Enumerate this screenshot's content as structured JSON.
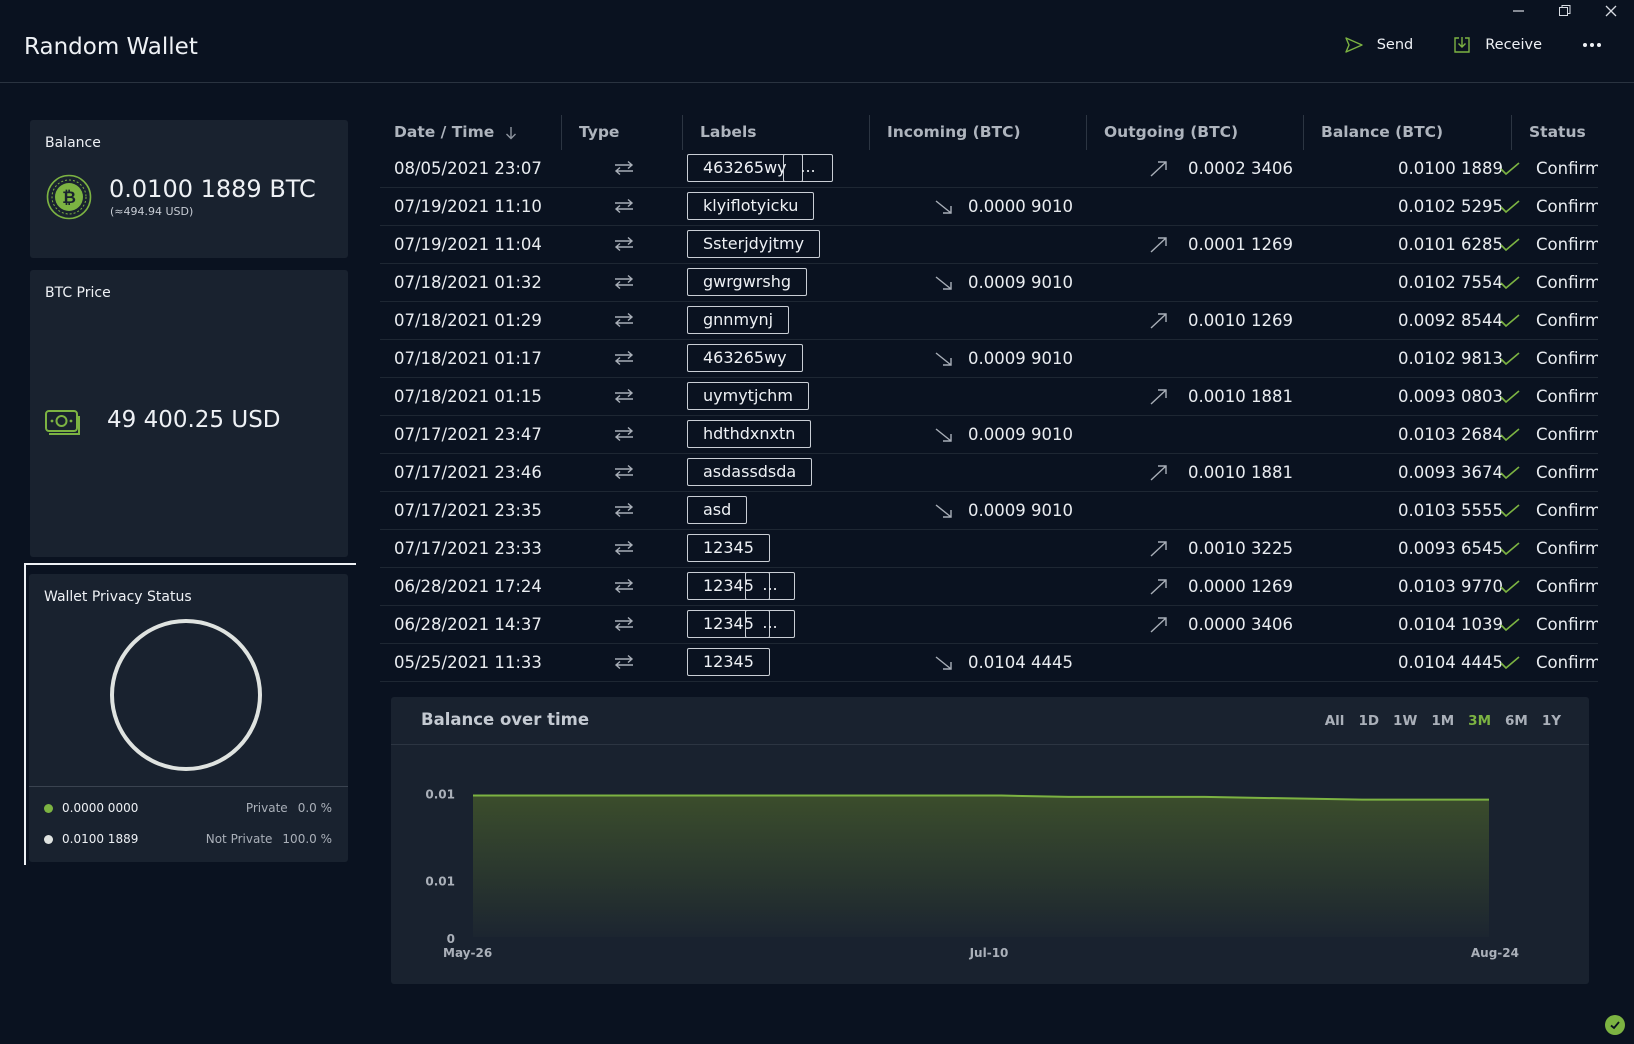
{
  "window": {
    "title": "Random Wallet",
    "controls": [
      "minimize-icon",
      "restore-icon",
      "close-icon"
    ]
  },
  "header": {
    "send_label": "Send",
    "receive_label": "Receive",
    "more_icon": "more-icon"
  },
  "balance_tile": {
    "title": "Balance",
    "amount": "0.0100 1889 BTC",
    "usd": "(≈494.94 USD)"
  },
  "price_tile": {
    "title": "BTC Price",
    "value": "49 400.25 USD"
  },
  "privacy_tile": {
    "title": "Wallet Privacy Status",
    "rows": [
      {
        "amount": "0.0000 0000",
        "label": "Private",
        "pct": "0.0 %",
        "color": "#7cb342"
      },
      {
        "amount": "0.0100 1889",
        "label": "Not Private",
        "pct": "100.0 %",
        "color": "#dfe3e0"
      }
    ]
  },
  "table": {
    "headers": {
      "date": "Date / Time",
      "type": "Type",
      "labels": "Labels",
      "incoming": "Incoming (BTC)",
      "outgoing": "Outgoing (BTC)",
      "balance": "Balance (BTC)",
      "status": "Status"
    },
    "rows": [
      {
        "date": "08/05/2021 23:07",
        "label": "463265wy",
        "more": "...",
        "incoming": "",
        "outgoing": "0.0002 3406",
        "balance": "0.0100 1889",
        "status": "Confirmed"
      },
      {
        "date": "07/19/2021 11:10",
        "label": "klyiflotyicku",
        "more": "",
        "incoming": "0.0000 9010",
        "outgoing": "",
        "balance": "0.0102 5295",
        "status": "Confirmed"
      },
      {
        "date": "07/19/2021 11:04",
        "label": "Ssterjdyjtmy",
        "more": "",
        "incoming": "",
        "outgoing": "0.0001 1269",
        "balance": "0.0101 6285",
        "status": "Confirmed"
      },
      {
        "date": "07/18/2021 01:32",
        "label": "gwrgwrshg",
        "more": "",
        "incoming": "0.0009 9010",
        "outgoing": "",
        "balance": "0.0102 7554",
        "status": "Confirmed"
      },
      {
        "date": "07/18/2021 01:29",
        "label": "gnnmynj",
        "more": "",
        "incoming": "",
        "outgoing": "0.0010 1269",
        "balance": "0.0092 8544",
        "status": "Confirmed"
      },
      {
        "date": "07/18/2021 01:17",
        "label": "463265wy",
        "more": "",
        "incoming": "0.0009 9010",
        "outgoing": "",
        "balance": "0.0102 9813",
        "status": "Confirmed"
      },
      {
        "date": "07/18/2021 01:15",
        "label": "uymytjchm",
        "more": "",
        "incoming": "",
        "outgoing": "0.0010 1881",
        "balance": "0.0093 0803",
        "status": "Confirmed"
      },
      {
        "date": "07/17/2021 23:47",
        "label": "hdthdxnxtn",
        "more": "",
        "incoming": "0.0009 9010",
        "outgoing": "",
        "balance": "0.0103 2684",
        "status": "Confirmed"
      },
      {
        "date": "07/17/2021 23:46",
        "label": "asdassdsda",
        "more": "",
        "incoming": "",
        "outgoing": "0.0010 1881",
        "balance": "0.0093 3674",
        "status": "Confirmed"
      },
      {
        "date": "07/17/2021 23:35",
        "label": "asd",
        "more": "",
        "incoming": "0.0009 9010",
        "outgoing": "",
        "balance": "0.0103 5555",
        "status": "Confirmed"
      },
      {
        "date": "07/17/2021 23:33",
        "label": "12345",
        "more": "",
        "incoming": "",
        "outgoing": "0.0010 3225",
        "balance": "0.0093 6545",
        "status": "Confirmed"
      },
      {
        "date": "06/28/2021 17:24",
        "label": "12345",
        "more": "...",
        "incoming": "",
        "outgoing": "0.0000 1269",
        "balance": "0.0103 9770",
        "status": "Confirmed"
      },
      {
        "date": "06/28/2021 14:37",
        "label": "12345",
        "more": "...",
        "incoming": "",
        "outgoing": "0.0000 3406",
        "balance": "0.0104 1039",
        "status": "Confirmed"
      },
      {
        "date": "05/25/2021 11:33",
        "label": "12345",
        "more": "",
        "incoming": "0.0104 4445",
        "outgoing": "",
        "balance": "0.0104 4445",
        "status": "Confirmed"
      }
    ]
  },
  "chart": {
    "title": "Balance over time",
    "ranges": [
      "All",
      "1D",
      "1W",
      "1M",
      "3M",
      "6M",
      "1Y"
    ],
    "active_range": "3M",
    "accent": "#7cb342",
    "chart_data": {
      "type": "area",
      "ytick_labels": [
        "0.01",
        "0.01",
        "0"
      ],
      "xtick_labels": [
        "May-26",
        "Jul-10",
        "Aug-24"
      ],
      "ylim": [
        0,
        0.0125
      ],
      "series": [
        {
          "x": [
            "May-26",
            "Jun-28",
            "Jun-28",
            "Jul-17",
            "Jul-19",
            "Aug-05",
            "Aug-24"
          ],
          "values": [
            0.0104,
            0.0104,
            0.0104,
            0.0103,
            0.0103,
            0.0101,
            0.0101
          ]
        }
      ]
    }
  }
}
